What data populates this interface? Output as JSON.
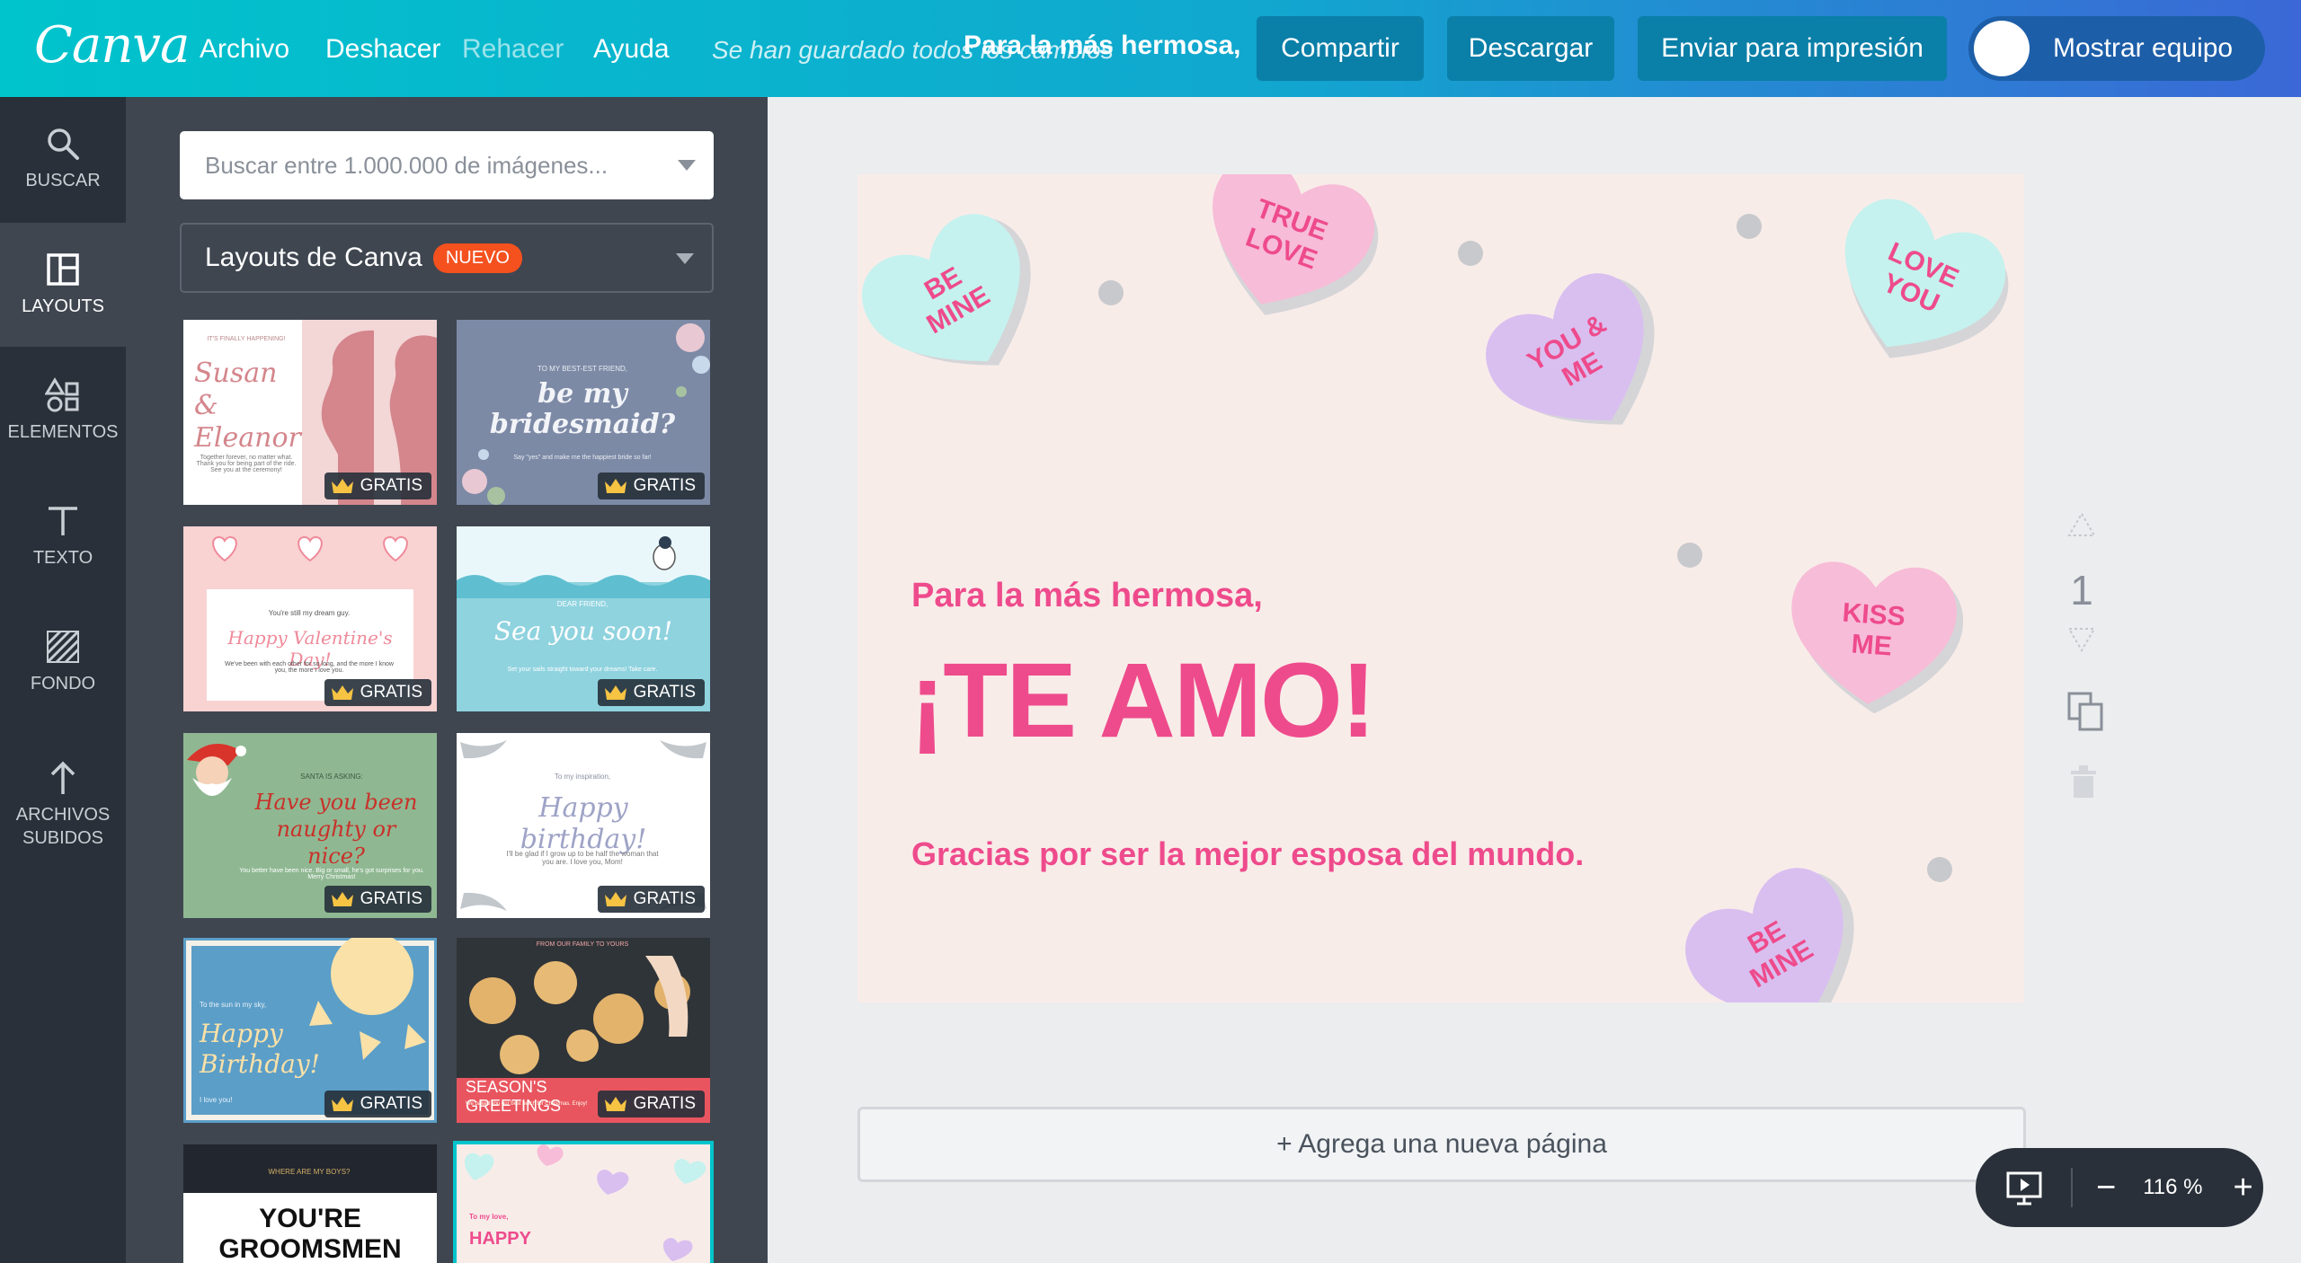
{
  "app": {
    "logo": "Canva",
    "menu": {
      "file": "Archivo",
      "undo": "Deshacer",
      "redo": "Rehacer",
      "help": "Ayuda"
    },
    "save_status": "Se han guardado todos los cambios",
    "doc_title": "Para la más hermosa,",
    "buttons": {
      "share": "Compartir",
      "download": "Descargar",
      "print": "Enviar para impresión",
      "show_team": "Mostrar equipo"
    },
    "brand_color": "#00c4cc"
  },
  "sidebar": {
    "items": [
      {
        "label": "BUSCAR",
        "icon": "search-icon"
      },
      {
        "label": "LAYOUTS",
        "icon": "layouts-icon",
        "active": true
      },
      {
        "label": "ELEMENTOS",
        "icon": "elements-icon"
      },
      {
        "label": "TEXTO",
        "icon": "text-icon"
      },
      {
        "label": "FONDO",
        "icon": "background-icon"
      },
      {
        "label": "ARCHIVOS",
        "label2": "SUBIDOS",
        "icon": "upload-icon"
      }
    ]
  },
  "panel": {
    "search_placeholder": "Buscar entre 1.000.000 de imágenes...",
    "select_label": "Layouts de Canva",
    "new_badge": "NUEVO",
    "free_label": "GRATIS",
    "templates": {
      "t1": {
        "pre": "IT'S FINALLY HAPPENING!",
        "script": "Susan & Eleanor",
        "body": "Together forever, no matter what. Thank you for being part of the ride. See you at the ceremony!"
      },
      "t2": {
        "pre": "TO MY BEST-EST FRIEND,",
        "script": "be my bridesmaid?",
        "body": "Say \"yes\" and make me the happiest bride so far!"
      },
      "t3": {
        "pre": "You're still my dream guy.",
        "script": "Happy Valentine's Day!",
        "body": "We've been with each other for so long, and the more I know you, the more I love you."
      },
      "t4": {
        "pre": "DEAR FRIEND,",
        "script": "Sea you soon!",
        "body": "Set your sails straight toward your dreams! Take care."
      },
      "t5": {
        "pre": "SANTA IS ASKING:",
        "script": "Have you been naughty or nice?",
        "body": "You better have been nice. Big or small, he's got surprises for you. Merry Christmas!"
      },
      "t6": {
        "pre": "To my inspiration,",
        "script": "Happy birthday!",
        "body": "I'll be glad if I grow up to be half the woman that you are. I love you, Mom!"
      },
      "t7": {
        "pre": "To the sun in my sky,",
        "script": "Happy Birthday!",
        "body": "I love you!"
      },
      "t8": {
        "pre": "FROM OUR FAMILY TO YOURS",
        "script": "SEASON'S GREETINGS",
        "body": "We baked you our best batch for Christmas. Enjoy!"
      },
      "t9": {
        "pre": "WHERE ARE MY BOYS?",
        "script": "YOU'RE GROOMSMEN"
      },
      "t10": {
        "pre": "To my love,",
        "script": "HAPPY"
      }
    }
  },
  "design": {
    "greeting": "Para la más hermosa,",
    "headline": "¡TE AMO!",
    "subline": "Gracias por ser la mejor esposa del mundo.",
    "hearts": [
      {
        "line1": "BE",
        "line2": "MINE",
        "color": "#c5f2ee"
      },
      {
        "line1": "TRUE",
        "line2": "LOVE",
        "color": "#f7bcd7"
      },
      {
        "line1": "YOU &",
        "line2": "ME",
        "color": "#d9bff0"
      },
      {
        "line1": "LOVE",
        "line2": "YOU",
        "color": "#c5f2ee"
      },
      {
        "line1": "KISS",
        "line2": "ME",
        "color": "#f7bcd7"
      },
      {
        "line1": "BE",
        "line2": "MINE",
        "color": "#d9bff0"
      }
    ],
    "text_color": "#ee4b8c",
    "background": "#f8ece9"
  },
  "page_number": "1",
  "add_page": "+ Agrega una nueva página",
  "zoom": {
    "level": "116 %",
    "out": "−",
    "in": "+"
  }
}
